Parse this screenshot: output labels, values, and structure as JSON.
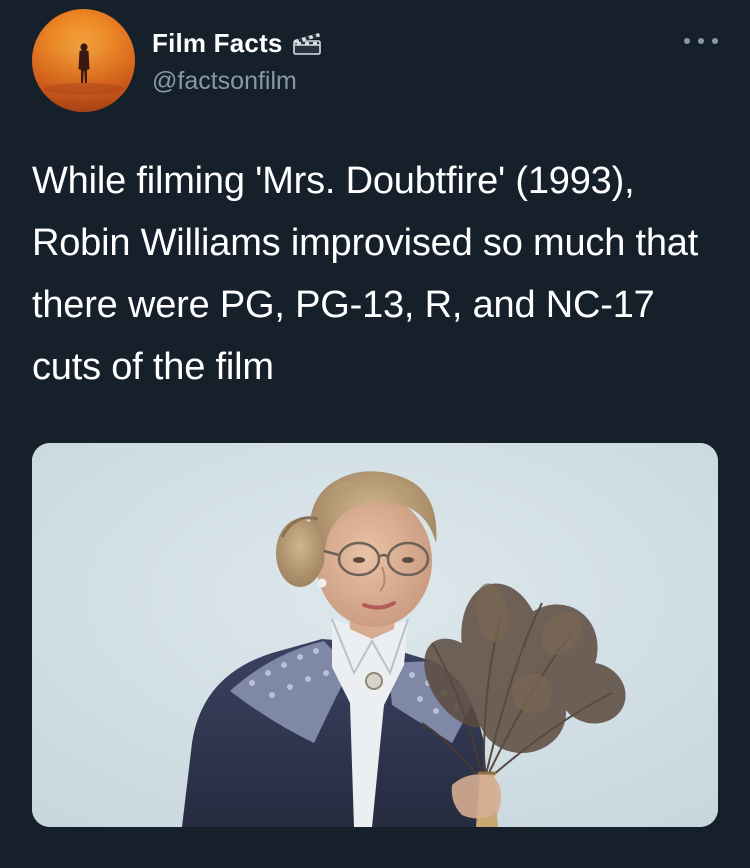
{
  "tweet": {
    "author": {
      "display_name": "Film Facts",
      "handle": "@factsonfilm",
      "badge_icon": "clapperboard-icon"
    },
    "text": "While filming 'Mrs. Doubtfire' (1993), Robin Williams improvised so much that there were PG, PG-13, R, and NC-17 cuts of the film",
    "media": {
      "icon": "photo"
    }
  },
  "colors": {
    "background": "#15202b",
    "secondary_text": "#8899a6",
    "avatar_orange": "#ef8a24"
  }
}
